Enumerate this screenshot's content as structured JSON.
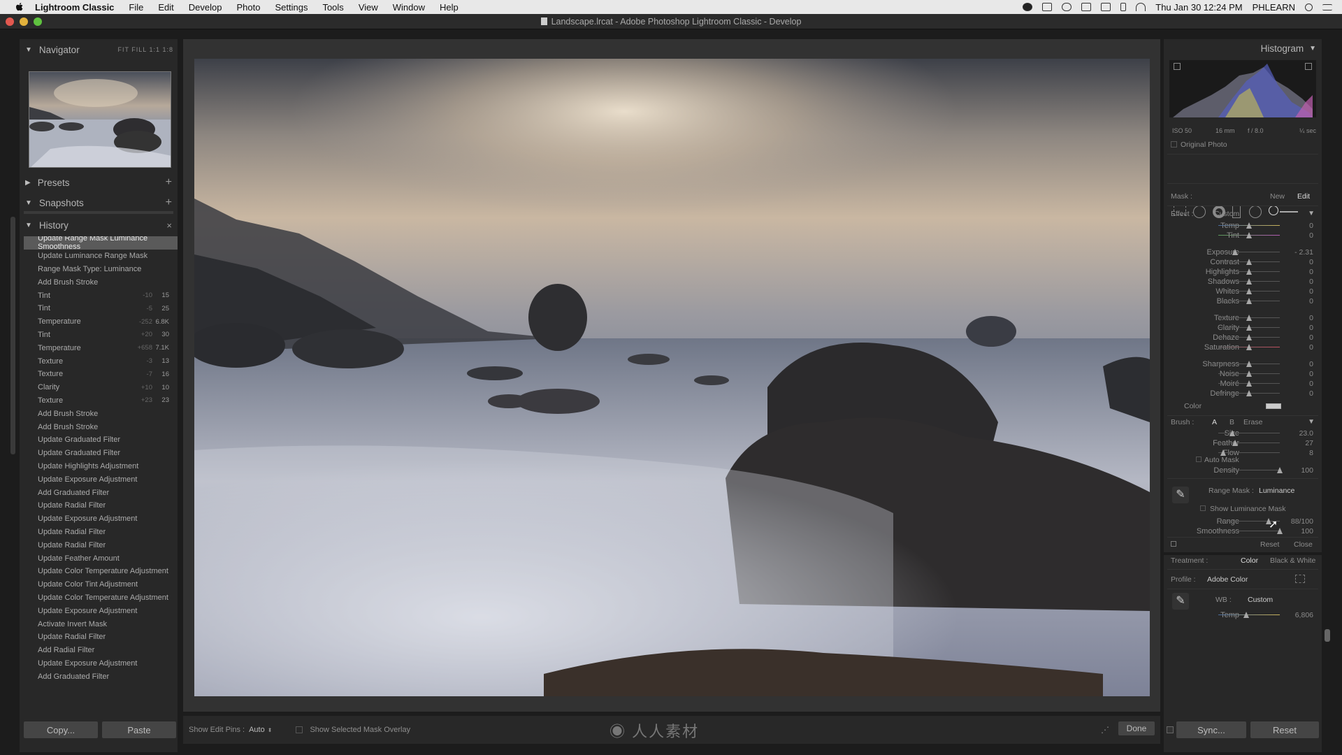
{
  "menubar": {
    "app_name": "Lightroom Classic",
    "items": [
      "File",
      "Edit",
      "Develop",
      "Photo",
      "Settings",
      "Tools",
      "View",
      "Window",
      "Help"
    ],
    "clock": "Thu Jan 30  12:24 PM",
    "user": "PHLEARN"
  },
  "window": {
    "title": "Landscape.lrcat - Adobe Photoshop Lightroom Classic - Develop"
  },
  "left_panel": {
    "navigator": {
      "title": "Navigator",
      "zoom_options": "FIT  FILL  1:1  1:8"
    },
    "presets": {
      "title": "Presets"
    },
    "snapshots": {
      "title": "Snapshots"
    },
    "history": {
      "title": "History",
      "items": [
        {
          "label": "Update Range Mask Luminance Smoothness",
          "v1": "",
          "v2": ""
        },
        {
          "label": "Update Luminance Range Mask",
          "v1": "",
          "v2": ""
        },
        {
          "label": "Range Mask Type: Luminance",
          "v1": "",
          "v2": ""
        },
        {
          "label": "Add Brush Stroke",
          "v1": "",
          "v2": ""
        },
        {
          "label": "Tint",
          "v1": "-10",
          "v2": "15"
        },
        {
          "label": "Tint",
          "v1": "-5",
          "v2": "25"
        },
        {
          "label": "Temperature",
          "v1": "-252",
          "v2": "6.8K"
        },
        {
          "label": "Tint",
          "v1": "+20",
          "v2": "30"
        },
        {
          "label": "Temperature",
          "v1": "+658",
          "v2": "7.1K"
        },
        {
          "label": "Texture",
          "v1": "-3",
          "v2": "13"
        },
        {
          "label": "Texture",
          "v1": "-7",
          "v2": "16"
        },
        {
          "label": "Clarity",
          "v1": "+10",
          "v2": "10"
        },
        {
          "label": "Texture",
          "v1": "+23",
          "v2": "23"
        },
        {
          "label": "Add Brush Stroke",
          "v1": "",
          "v2": ""
        },
        {
          "label": "Add Brush Stroke",
          "v1": "",
          "v2": ""
        },
        {
          "label": "Update Graduated Filter",
          "v1": "",
          "v2": ""
        },
        {
          "label": "Update Graduated Filter",
          "v1": "",
          "v2": ""
        },
        {
          "label": "Update Highlights Adjustment",
          "v1": "",
          "v2": ""
        },
        {
          "label": "Update Exposure Adjustment",
          "v1": "",
          "v2": ""
        },
        {
          "label": "Add Graduated Filter",
          "v1": "",
          "v2": ""
        },
        {
          "label": "Update Radial Filter",
          "v1": "",
          "v2": ""
        },
        {
          "label": "Update Exposure Adjustment",
          "v1": "",
          "v2": ""
        },
        {
          "label": "Update Radial Filter",
          "v1": "",
          "v2": ""
        },
        {
          "label": "Update Radial Filter",
          "v1": "",
          "v2": ""
        },
        {
          "label": "Update Feather Amount",
          "v1": "",
          "v2": ""
        },
        {
          "label": "Update Color Temperature Adjustment",
          "v1": "",
          "v2": ""
        },
        {
          "label": "Update Color Tint Adjustment",
          "v1": "",
          "v2": ""
        },
        {
          "label": "Update Color Temperature Adjustment",
          "v1": "",
          "v2": ""
        },
        {
          "label": "Update Exposure Adjustment",
          "v1": "",
          "v2": ""
        },
        {
          "label": "Activate Invert Mask",
          "v1": "",
          "v2": ""
        },
        {
          "label": "Update Radial Filter",
          "v1": "",
          "v2": ""
        },
        {
          "label": "Add Radial Filter",
          "v1": "",
          "v2": ""
        },
        {
          "label": "Update Exposure Adjustment",
          "v1": "",
          "v2": ""
        },
        {
          "label": "Add Graduated Filter",
          "v1": "",
          "v2": ""
        }
      ]
    },
    "copy_label": "Copy...",
    "paste_label": "Paste"
  },
  "toolbar": {
    "show_edit_pins_label": "Show Edit Pins :",
    "show_edit_pins_value": "Auto",
    "show_mask_overlay_label": "Show Selected Mask Overlay",
    "done_label": "Done"
  },
  "right_panel": {
    "histogram": {
      "title": "Histogram",
      "iso": "ISO 50",
      "focal": "16 mm",
      "aperture": "f / 8.0",
      "shutter": "¼ sec",
      "original_photo": "Original Photo"
    },
    "mask": {
      "label": "Mask :",
      "new": "New",
      "edit": "Edit"
    },
    "effect": {
      "label": "Effect :",
      "value": "Custom"
    },
    "sliders": [
      {
        "label": "Temp",
        "value": "0",
        "pos": 0.5
      },
      {
        "label": "Tint",
        "value": "0",
        "pos": 0.5
      },
      {
        "label": "Exposure",
        "value": "- 2.31",
        "pos": 0.27
      },
      {
        "label": "Contrast",
        "value": "0",
        "pos": 0.5
      },
      {
        "label": "Highlights",
        "value": "0",
        "pos": 0.5
      },
      {
        "label": "Shadows",
        "value": "0",
        "pos": 0.5
      },
      {
        "label": "Whites",
        "value": "0",
        "pos": 0.5
      },
      {
        "label": "Blacks",
        "value": "0",
        "pos": 0.5
      },
      {
        "label": "Texture",
        "value": "0",
        "pos": 0.5
      },
      {
        "label": "Clarity",
        "value": "0",
        "pos": 0.5
      },
      {
        "label": "Dehaze",
        "value": "0",
        "pos": 0.5
      },
      {
        "label": "Saturation",
        "value": "0",
        "pos": 0.5
      },
      {
        "label": "Sharpness",
        "value": "0",
        "pos": 0.5
      },
      {
        "label": "Noise",
        "value": "0",
        "pos": 0.5
      },
      {
        "label": "Moiré",
        "value": "0",
        "pos": 0.5
      },
      {
        "label": "Defringe",
        "value": "0",
        "pos": 0.5
      }
    ],
    "color_label": "Color",
    "brush": {
      "label": "Brush :",
      "a": "A",
      "b": "B",
      "erase": "Erase"
    },
    "brush_sliders": [
      {
        "label": "Size",
        "value": "23.0",
        "pos": 0.23
      },
      {
        "label": "Feather",
        "value": "27",
        "pos": 0.27
      },
      {
        "label": "Flow",
        "value": "8",
        "pos": 0.08
      }
    ],
    "auto_mask": "Auto Mask",
    "density": {
      "label": "Density",
      "value": "100",
      "pos": 1.0
    },
    "range_mask": {
      "label": "Range Mask :",
      "value": "Luminance"
    },
    "show_luminance_mask": "Show Luminance Mask",
    "range": {
      "label": "Range",
      "value": "88/100",
      "pos": 0.88
    },
    "smoothness": {
      "label": "Smoothness",
      "value": "100",
      "pos": 1.0
    },
    "reset_label": "Reset",
    "close_label": "Close",
    "treatment": {
      "label": "Treatment :",
      "color": "Color",
      "bw": "Black & White"
    },
    "profile": {
      "label": "Profile :",
      "value": "Adobe Color"
    },
    "wb": {
      "label": "WB :",
      "value": "Custom"
    },
    "temp": {
      "label": "Temp",
      "value": "6,806",
      "pos": 0.45
    },
    "sync_label": "Sync...",
    "reset_bottom_label": "Reset"
  }
}
